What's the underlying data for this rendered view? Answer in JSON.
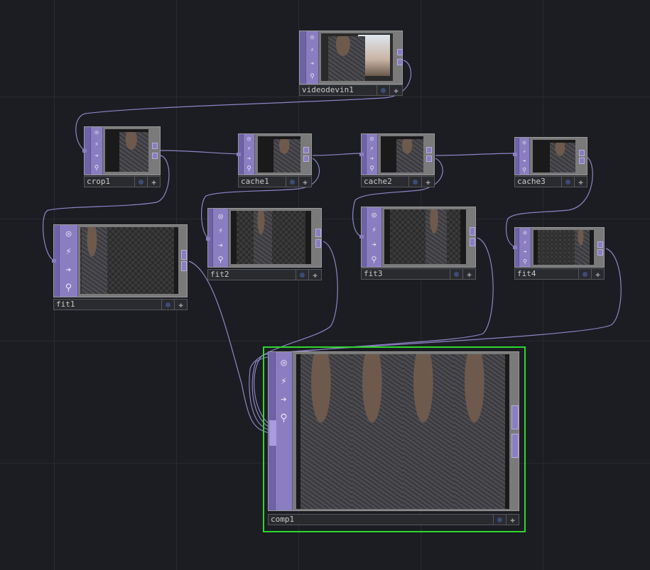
{
  "colors": {
    "background": "#1b1d22",
    "grid": "#272a30",
    "node_side": "#8a7ec0",
    "wire": "#8f84c8",
    "selected": "#2ed82e"
  },
  "side_icons": [
    "viewer-toggle-icon",
    "cook-icon",
    "bypass-arrow-icon",
    "lock-icon"
  ],
  "nodes": {
    "videodevin1": {
      "name": "videodevin1"
    },
    "crop1": {
      "name": "crop1"
    },
    "cache1": {
      "name": "cache1"
    },
    "cache2": {
      "name": "cache2"
    },
    "cache3": {
      "name": "cache3"
    },
    "fit1": {
      "name": "fit1"
    },
    "fit2": {
      "name": "fit2"
    },
    "fit3": {
      "name": "fit3"
    },
    "fit4": {
      "name": "fit4"
    },
    "comp1": {
      "name": "comp1",
      "selected": true
    }
  },
  "connections": [
    [
      "videodevin1",
      "crop1"
    ],
    [
      "crop1",
      "cache1"
    ],
    [
      "crop1",
      "fit1"
    ],
    [
      "cache1",
      "cache2"
    ],
    [
      "cache1",
      "fit2"
    ],
    [
      "cache2",
      "cache3"
    ],
    [
      "cache2",
      "fit3"
    ],
    [
      "cache3",
      "fit4"
    ],
    [
      "fit1",
      "comp1"
    ],
    [
      "fit2",
      "comp1"
    ],
    [
      "fit3",
      "comp1"
    ],
    [
      "fit4",
      "comp1"
    ]
  ]
}
